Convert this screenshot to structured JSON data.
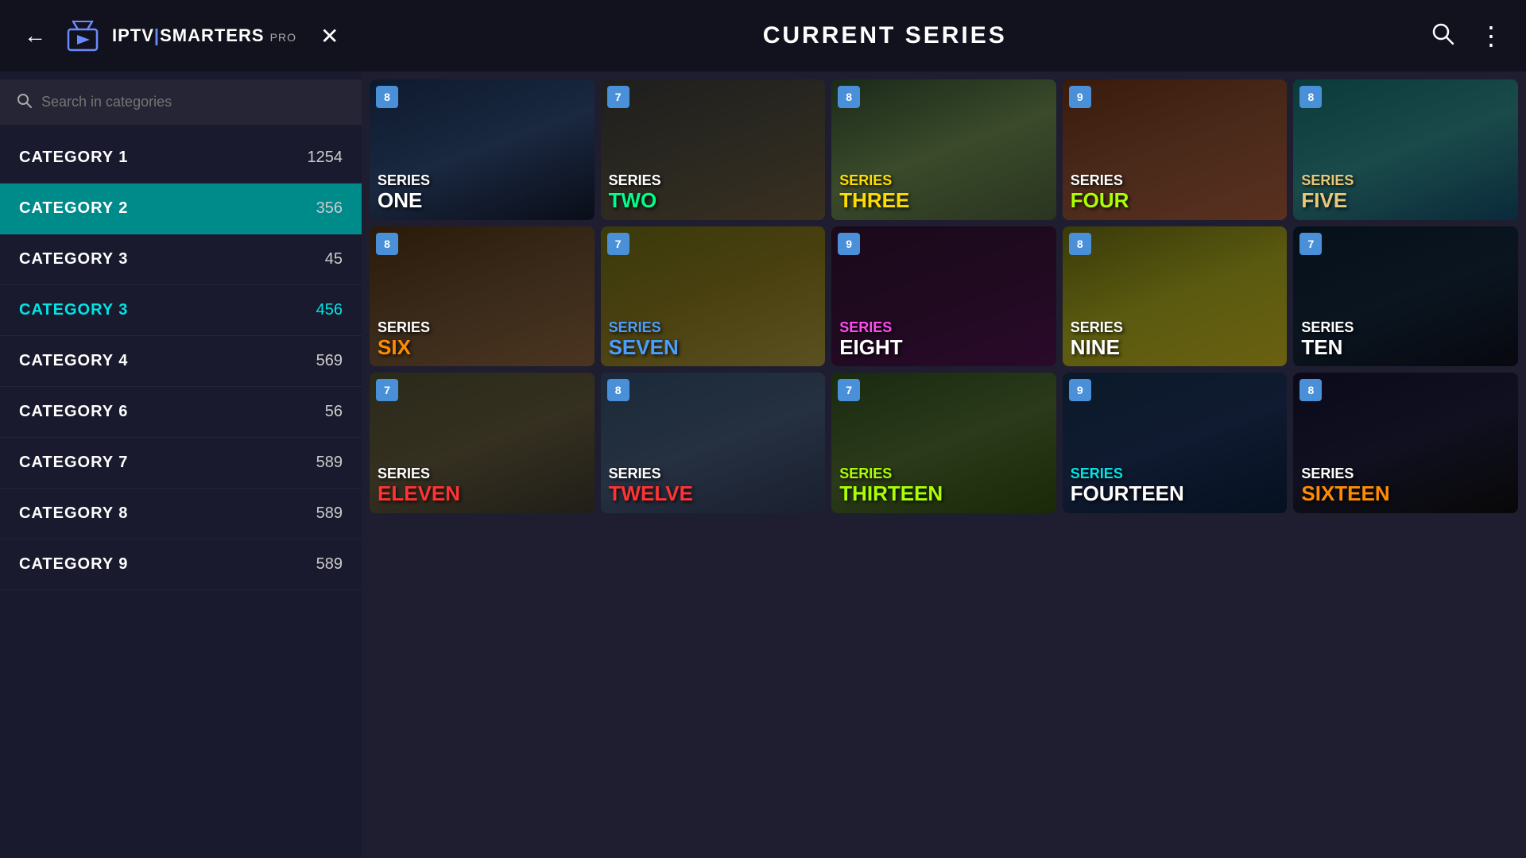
{
  "header": {
    "title": "CURRENT SERIES",
    "back_label": "←",
    "close_label": "✕",
    "search_icon": "🔍",
    "menu_icon": "⋮",
    "logo_text_iptv": "IPTV",
    "logo_text_smarters": "SMARTERS",
    "logo_text_pro": "PRO"
  },
  "sidebar": {
    "search_placeholder": "Search in categories",
    "categories": [
      {
        "name": "CATEGORY  1",
        "count": "1254",
        "active": false,
        "highlighted": false
      },
      {
        "name": "CATEGORY  2",
        "count": "356",
        "active": true,
        "highlighted": false
      },
      {
        "name": "CATEGORY  3",
        "count": "45",
        "active": false,
        "highlighted": false
      },
      {
        "name": "CATEGORY  3",
        "count": "456",
        "active": false,
        "highlighted": true
      },
      {
        "name": "CATEGORY  4",
        "count": "569",
        "active": false,
        "highlighted": false
      },
      {
        "name": "CATEGORY  6",
        "count": "56",
        "active": false,
        "highlighted": false
      },
      {
        "name": "CATEGORY  7",
        "count": "589",
        "active": false,
        "highlighted": false
      },
      {
        "name": "CATEGORY  8",
        "count": "589",
        "active": false,
        "highlighted": false
      },
      {
        "name": "CATEGORY  9",
        "count": "589",
        "active": false,
        "highlighted": false
      }
    ]
  },
  "grid": {
    "cards": [
      {
        "id": 1,
        "badge": "8",
        "line1": "SERIES",
        "line2": "ONE",
        "line1_color": "white",
        "line2_color": "white",
        "bg": "bg-1"
      },
      {
        "id": 2,
        "badge": "7",
        "line1": "SERIES",
        "line2": "TWO",
        "line1_color": "white",
        "line2_color": "green",
        "bg": "bg-2"
      },
      {
        "id": 3,
        "badge": "8",
        "line1": "SERIES",
        "line2": "THREE",
        "line1_color": "yellow",
        "line2_color": "yellow",
        "bg": "bg-3"
      },
      {
        "id": 4,
        "badge": "9",
        "line1": "SERIES",
        "line2": "FOUR",
        "line1_color": "white",
        "line2_color": "lime",
        "bg": "bg-4"
      },
      {
        "id": 5,
        "badge": "8",
        "line1": "SERIES",
        "line2": "FIVE",
        "line1_color": "sand",
        "line2_color": "sand",
        "bg": "bg-5"
      },
      {
        "id": 6,
        "badge": "8",
        "line1": "SERIES",
        "line2": "SIX",
        "line1_color": "white",
        "line2_color": "orange",
        "bg": "bg-6"
      },
      {
        "id": 7,
        "badge": "7",
        "line1": "SERIES",
        "line2": "SEVEN",
        "line1_color": "blue",
        "line2_color": "blue",
        "bg": "bg-7"
      },
      {
        "id": 8,
        "badge": "9",
        "line1": "SERIES",
        "line2": "EIGHT",
        "line1_color": "pink",
        "line2_color": "white",
        "bg": "bg-8"
      },
      {
        "id": 9,
        "badge": "8",
        "line1": "SERIES",
        "line2": "NINE",
        "line1_color": "white",
        "line2_color": "white",
        "bg": "bg-9"
      },
      {
        "id": 10,
        "badge": "7",
        "line1": "SERIES",
        "line2": "TEN",
        "line1_color": "white",
        "line2_color": "white",
        "bg": "bg-10"
      },
      {
        "id": 11,
        "badge": "7",
        "line1": "SERIES",
        "line2": "ELEVEN",
        "line1_color": "white",
        "line2_color": "red",
        "bg": "bg-11"
      },
      {
        "id": 12,
        "badge": "8",
        "line1": "SERIES",
        "line2": "TWELVE",
        "line1_color": "white",
        "line2_color": "red",
        "bg": "bg-12"
      },
      {
        "id": 13,
        "badge": "7",
        "line1": "SERIES",
        "line2": "THIRTEEN",
        "line1_color": "lime",
        "line2_color": "lime",
        "bg": "bg-13"
      },
      {
        "id": 14,
        "badge": "9",
        "line1": "SERIES",
        "line2": "FOURTEEN",
        "line1_color": "cyan",
        "line2_color": "white",
        "bg": "bg-14"
      },
      {
        "id": 15,
        "badge": "8",
        "line1": "SERIES",
        "line2": "SIXTEEN",
        "line1_color": "white",
        "line2_color": "orange",
        "bg": "bg-15"
      }
    ]
  },
  "colors": {
    "accent": "#008b8b",
    "highlighted": "#00e5e5",
    "badge": "#4a90d9",
    "sidebar_bg": "#1a1a2e",
    "header_bg": "#12121e"
  }
}
